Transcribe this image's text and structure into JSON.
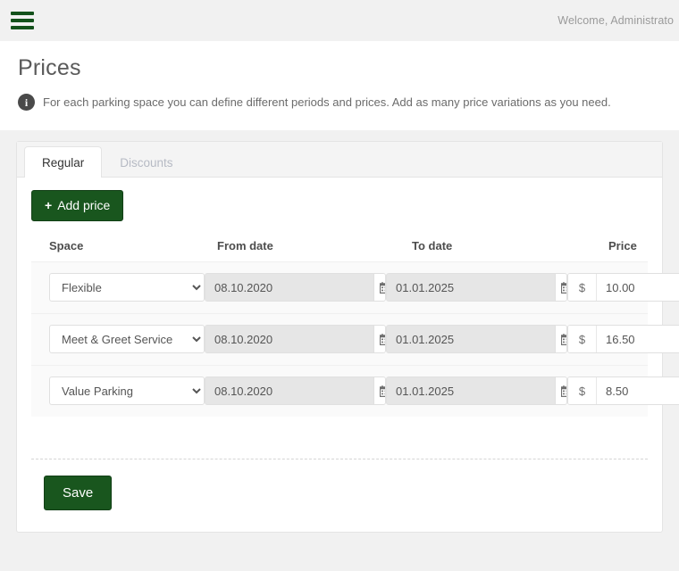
{
  "topbar": {
    "menu_icon": "hamburger-menu-icon",
    "welcome": "Welcome, Administrato"
  },
  "page": {
    "title": "Prices",
    "info_icon": "i",
    "info_text": "For each parking space you can define different periods and prices. Add as many price variations as you need."
  },
  "tabs": [
    {
      "label": "Regular",
      "active": true
    },
    {
      "label": "Discounts",
      "active": false
    }
  ],
  "toolbar": {
    "add_price_label": "Add price",
    "add_price_plus": "+"
  },
  "table": {
    "headers": {
      "space": "Space",
      "from_date": "From date",
      "to_date": "To date",
      "price": "Price"
    },
    "rows": [
      {
        "space": "Flexible",
        "from_date": "08.10.2020",
        "to_date": "01.01.2025",
        "currency": "$",
        "price": "10.00"
      },
      {
        "space": "Meet & Greet Service",
        "from_date": "08.10.2020",
        "to_date": "01.01.2025",
        "currency": "$",
        "price": "16.50"
      },
      {
        "space": "Value Parking",
        "from_date": "08.10.2020",
        "to_date": "01.01.2025",
        "currency": "$",
        "price": "8.50"
      }
    ]
  },
  "footer": {
    "save_label": "Save"
  },
  "colors": {
    "brand_green": "#19561e",
    "page_bg": "#f1f1f1",
    "card_bg": "#ffffff",
    "muted_text": "#9a9a9a"
  }
}
